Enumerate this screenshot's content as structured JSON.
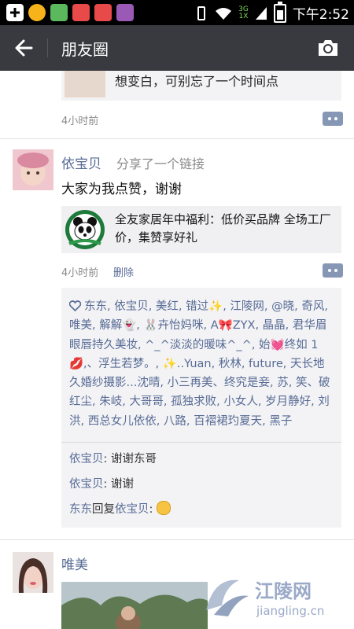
{
  "status_bar": {
    "time": "下午2:52",
    "network_top": "3G",
    "network_bottom": "1X"
  },
  "header": {
    "title": "朋友圈"
  },
  "prev_post": {
    "text": "想变白，可别忘了一个时间点",
    "time": "4小时前"
  },
  "post1": {
    "author": "依宝贝",
    "shared_label": "分享了一个链接",
    "text": "大家为我点赞，谢谢",
    "link_title": "全友家居年中福利：低价买品牌 全场工厂价，集赞享好礼",
    "time": "4小时前",
    "delete_label": "删除",
    "likes": "东东, 依宝贝, 美红, 错过✨, 江陵网, @晓, 奇风, 唯美, 解解👻, 🐰卉怡妈咪, A🎀ZYX, 晶晶, 君华眉眼唇持久美妆, ^_^淡淡的暖味^_^, 始💓终如 1💋,、浮生若梦。, ✨..Yuan, 秋林, future, 天长地久婚纱摄影...沈晴, 小三再美、终究是妾, 苏, 笑、破红尘, 朱岐, 大哥哥, 孤独求败, 小女人, 岁月静好, 刘洪, 西总女儿依依, 八路, 百褶裙玓夏天, 黑子",
    "comments": [
      {
        "name": "依宝贝",
        "sep": ": ",
        "text": "谢谢东哥",
        "emoji": ""
      },
      {
        "name": "依宝贝",
        "sep": ": ",
        "text": "谢谢",
        "emoji": ""
      },
      {
        "name": "东东",
        "mid": "回复",
        "name2": "依宝贝",
        "sep": ": ",
        "text": "",
        "emoji": "smile"
      }
    ]
  },
  "post2": {
    "author": "唯美"
  },
  "watermark": {
    "brand": "江陵网",
    "url": "jiangling.cn"
  }
}
